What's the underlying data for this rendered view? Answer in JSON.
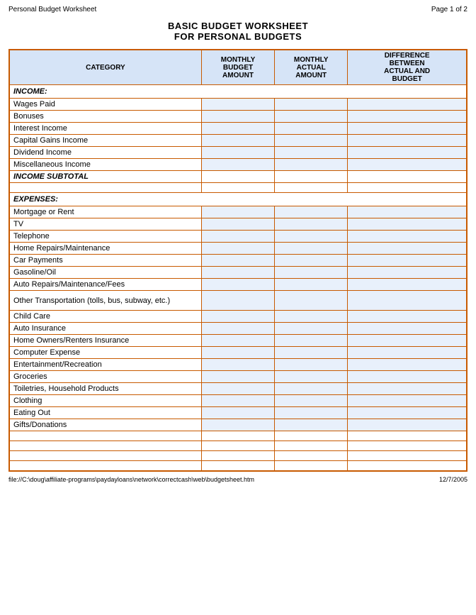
{
  "header": {
    "title": "Personal Budget Worksheet",
    "page": "Page 1 of 2"
  },
  "main_title_line1": "BASIC BUDGET WORKSHEET",
  "main_title_line2": "FOR PERSONAL BUDGETS",
  "columns": {
    "category": "CATEGORY",
    "monthly_budget": "MONTHLY BUDGET AMOUNT",
    "monthly_actual": "MONTHLY ACTUAL AMOUNT",
    "difference": "DIFFERENCE BETWEEN ACTUAL AND BUDGET"
  },
  "sections": [
    {
      "type": "section_header",
      "label": "INCOME:"
    },
    {
      "type": "data_row",
      "label": "Wages Paid"
    },
    {
      "type": "data_row",
      "label": "Bonuses"
    },
    {
      "type": "data_row",
      "label": "Interest Income"
    },
    {
      "type": "data_row",
      "label": "Capital Gains Income"
    },
    {
      "type": "data_row",
      "label": "Dividend Income"
    },
    {
      "type": "data_row",
      "label": "Miscellaneous Income"
    },
    {
      "type": "subtotal_row",
      "label": "INCOME SUBTOTAL"
    },
    {
      "type": "empty_row"
    },
    {
      "type": "section_header",
      "label": "EXPENSES:"
    },
    {
      "type": "data_row",
      "label": "Mortgage or Rent"
    },
    {
      "type": "data_row",
      "label": "TV"
    },
    {
      "type": "data_row",
      "label": "Telephone"
    },
    {
      "type": "data_row",
      "label": "Home Repairs/Maintenance"
    },
    {
      "type": "data_row",
      "label": "Car Payments"
    },
    {
      "type": "data_row",
      "label": "Gasoline/Oil"
    },
    {
      "type": "data_row",
      "label": "Auto Repairs/Maintenance/Fees"
    },
    {
      "type": "data_row_tall",
      "label": "Other Transportation (tolls, bus, subway, etc.)"
    },
    {
      "type": "data_row",
      "label": "Child Care"
    },
    {
      "type": "data_row",
      "label": "Auto Insurance"
    },
    {
      "type": "data_row",
      "label": "Home Owners/Renters Insurance"
    },
    {
      "type": "data_row",
      "label": "Computer Expense"
    },
    {
      "type": "data_row",
      "label": "Entertainment/Recreation"
    },
    {
      "type": "data_row",
      "label": "Groceries"
    },
    {
      "type": "data_row",
      "label": "Toiletries, Household Products"
    },
    {
      "type": "data_row",
      "label": "Clothing"
    },
    {
      "type": "data_row",
      "label": "Eating Out"
    },
    {
      "type": "data_row",
      "label": "Gifts/Donations"
    },
    {
      "type": "empty_row"
    },
    {
      "type": "empty_row"
    },
    {
      "type": "empty_row"
    },
    {
      "type": "empty_row"
    }
  ],
  "footer": {
    "path": "file://C:\\doug\\affiliate-programs\\paydayloans\\network\\correctcash\\web\\budgetsheet.htm",
    "date": "12/7/2005"
  }
}
